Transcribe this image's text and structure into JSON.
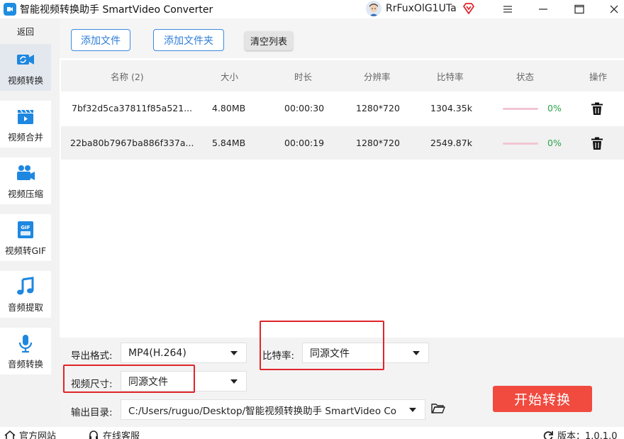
{
  "app": {
    "title": "智能视频转换助手 SmartVideo Converter",
    "username": "RrFuxOlG1UTa"
  },
  "sidebar": {
    "back_label": "返回",
    "items": [
      {
        "label": "视频转换",
        "icon": "video-convert-icon",
        "active": true
      },
      {
        "label": "视频合并",
        "icon": "clapperboard-icon"
      },
      {
        "label": "视频压缩",
        "icon": "video-camera-icon"
      },
      {
        "label": "视频转GIF",
        "icon": "gif-icon"
      },
      {
        "label": "音频提取",
        "icon": "music-note-icon"
      },
      {
        "label": "音频转换",
        "icon": "microphone-icon"
      }
    ]
  },
  "toolbar": {
    "add_file": "添加文件",
    "add_folder": "添加文件夹",
    "clear_list": "清空列表"
  },
  "table": {
    "headers": {
      "name": "名称 (2)",
      "size": "大小",
      "duration": "时长",
      "resolution": "分辨率",
      "bitrate": "比特率",
      "status": "状态",
      "action": "操作"
    },
    "rows": [
      {
        "name": "7bf32d5ca37811f85a521...",
        "size": "4.80MB",
        "duration": "00:00:30",
        "resolution": "1280*720",
        "bitrate": "1304.35k",
        "progress": "0%"
      },
      {
        "name": "22ba80b7967ba886f337a...",
        "size": "5.84MB",
        "duration": "00:00:19",
        "resolution": "1280*720",
        "bitrate": "2549.87k",
        "progress": "0%"
      }
    ]
  },
  "settings": {
    "format_label": "导出格式:",
    "format_value": "MP4(H.264)",
    "bitrate_label": "比特率:",
    "bitrate_value": "同源文件",
    "size_label": "视频尺寸:",
    "size_value": "同源文件",
    "output_label": "输出目录:",
    "output_value": "C:/Users/ruguo/Desktop/智能视频转换助手 SmartVideo Converter",
    "start_button": "开始转换"
  },
  "footer": {
    "website": "官方网站",
    "support": "在线客服",
    "version": "版本：1.0.1.0"
  },
  "colors": {
    "accent": "#2f7ed8",
    "start": "#f14a3f",
    "highlight": "#e0242b",
    "progress_text": "#2ba34a"
  }
}
